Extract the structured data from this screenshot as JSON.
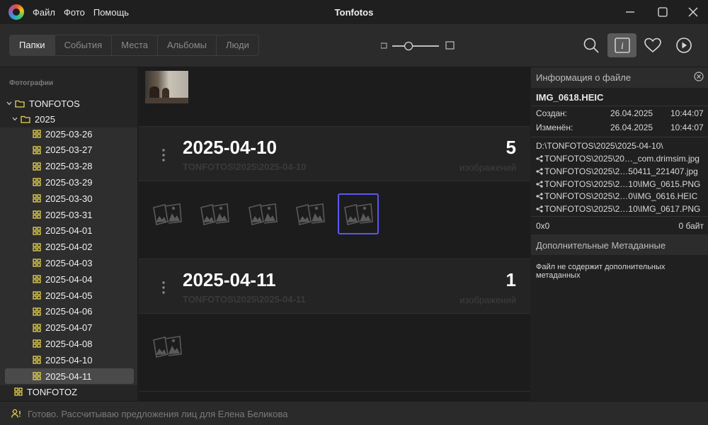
{
  "app": {
    "title": "Tonfotos"
  },
  "menu": [
    "Файл",
    "Фото",
    "Помощь"
  ],
  "tabs": [
    {
      "label": "Папки",
      "active": true
    },
    {
      "label": "События",
      "active": false
    },
    {
      "label": "Места",
      "active": false
    },
    {
      "label": "Альбомы",
      "active": false
    },
    {
      "label": "Люди",
      "active": false
    }
  ],
  "zoom_slider": {
    "value": 0.35
  },
  "sidebar": {
    "heading": "Фотографии",
    "root": "TONFOTOS",
    "year": "2025",
    "dates": [
      "2025-03-26",
      "2025-03-27",
      "2025-03-28",
      "2025-03-29",
      "2025-03-30",
      "2025-03-31",
      "2025-04-01",
      "2025-04-02",
      "2025-04-03",
      "2025-04-04",
      "2025-04-05",
      "2025-04-06",
      "2025-04-07",
      "2025-04-08",
      "2025-04-10",
      "2025-04-11"
    ],
    "selected": "2025-04-11",
    "other_root": "TONFOTOZ"
  },
  "groups": [
    {
      "title": "2025-04-10",
      "path": "TONFOTOS\\2025\\2025-04-10",
      "count": "5",
      "unit": "изображений",
      "thumbs": 5,
      "selected_thumb": 4
    },
    {
      "title": "2025-04-11",
      "path": "TONFOTOS\\2025\\2025-04-11",
      "count": "1",
      "unit": "изображений",
      "thumbs": 1,
      "selected_thumb": -1
    }
  ],
  "info": {
    "header": "Информация о файле",
    "filename": "IMG_0618.HEIC",
    "created_label": "Создан:",
    "created_date": "26.04.2025",
    "created_time": "10:44:07",
    "modified_label": "Изменён:",
    "modified_date": "26.04.2025",
    "modified_time": "10:44:07",
    "folder": "D:\\TONFOTOS\\2025\\2025-04-10\\",
    "files": [
      "TONFOTOS\\2025\\20…_com.drimsim.jpg",
      "TONFOTOS\\2025\\2…50411_221407.jpg",
      "TONFOTOS\\2025\\2…10\\IMG_0615.PNG",
      "TONFOTOS\\2025\\2…0\\IMG_0616.HEIC",
      "TONFOTOS\\2025\\2…10\\IMG_0617.PNG"
    ],
    "hex": "0x0",
    "size": "0 байт",
    "meta_header": "Дополнительные Метаданные",
    "meta_text_1": "Файл не содержит дополнительных",
    "meta_text_2": "метаданных"
  },
  "status": {
    "text": "Готово. Рассчитываю предложения лиц для Елена Беликова"
  },
  "colors": {
    "accent": "#5b57f0",
    "folder": "#e8d44d"
  }
}
